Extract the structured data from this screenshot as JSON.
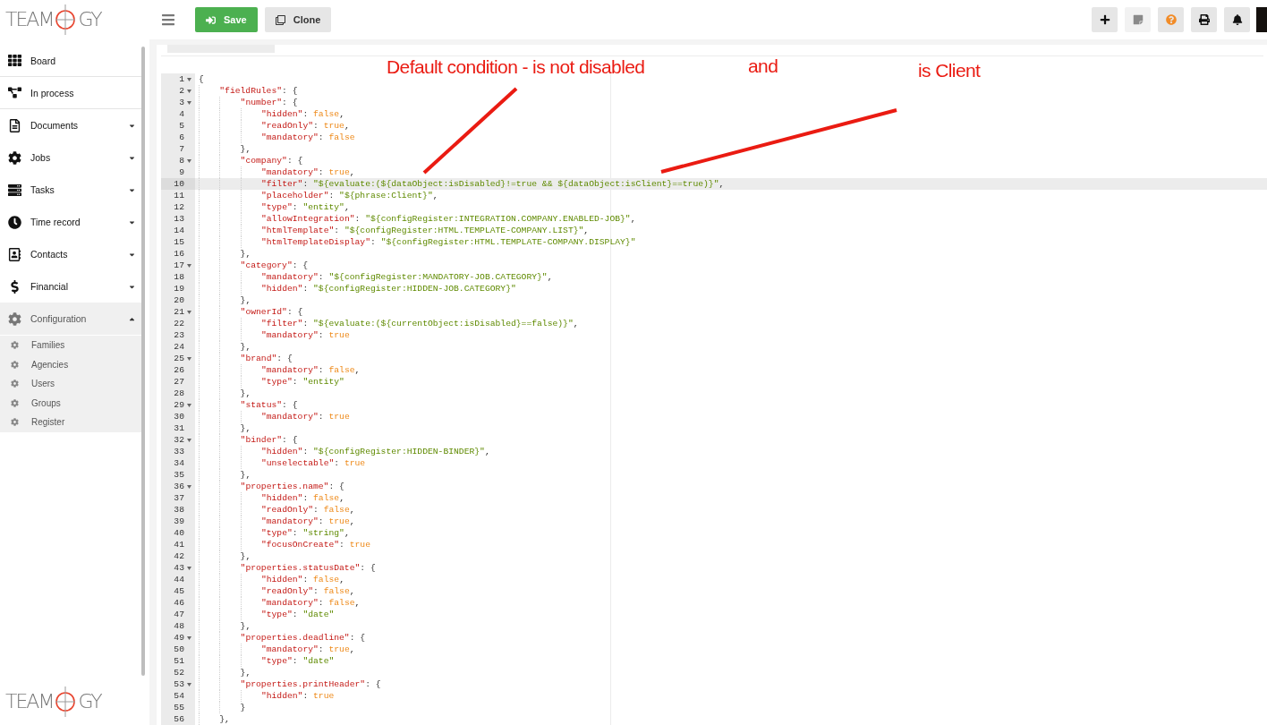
{
  "logo": {
    "before": "TEAM",
    "after": "GY"
  },
  "toolbar": {
    "buttons": [
      {
        "label": "Save",
        "kind": "primary"
      },
      {
        "label": "Clone",
        "kind": "secondary"
      }
    ],
    "actions": [
      {
        "disabled": false
      },
      {
        "disabled": true
      },
      {
        "disabled": false
      },
      {
        "disabled": false
      },
      {
        "disabled": false
      }
    ]
  },
  "sidebar": {
    "items": [
      {
        "label": "Board",
        "kind": "link"
      },
      {
        "label": "In process",
        "kind": "link"
      },
      {
        "label": "Documents",
        "kind": "group",
        "expanded": false
      },
      {
        "label": "Jobs",
        "kind": "group",
        "expanded": false
      },
      {
        "label": "Tasks",
        "kind": "group",
        "expanded": false
      },
      {
        "label": "Time record",
        "kind": "group",
        "expanded": false
      },
      {
        "label": "Contacts",
        "kind": "group",
        "expanded": false
      },
      {
        "label": "Financial",
        "kind": "group",
        "expanded": false
      },
      {
        "label": "Configuration",
        "kind": "group",
        "expanded": true,
        "children": [
          {
            "label": "Families"
          },
          {
            "label": "Agencies"
          },
          {
            "label": "Users"
          },
          {
            "label": "Groups"
          },
          {
            "label": "Register"
          }
        ]
      }
    ]
  },
  "footer_logo": {
    "before": "TEAM",
    "after": "GY"
  },
  "annotations": [
    {
      "text": "Default condition - is not disabled"
    },
    {
      "text": "and"
    },
    {
      "text": "is Client"
    }
  ],
  "code": {
    "lines": [
      {
        "number": "1",
        "selected": false,
        "tokens": [
          {
            "kind": "punct",
            "text": "{"
          }
        ],
        "children": [
          {
            "number": "2",
            "selected": false,
            "tokens": [
              {
                "kind": "key",
                "text": "\"fieldRules\""
              },
              {
                "kind": "punct",
                "text": ": {"
              }
            ],
            "children": [
              {
                "number": "3",
                "selected": false,
                "tokens": [
                  {
                    "kind": "key",
                    "text": "\"number\""
                  },
                  {
                    "kind": "punct",
                    "text": ": {"
                  }
                ],
                "children": [
                  {
                    "number": "4",
                    "selected": false,
                    "tokens": [
                      {
                        "kind": "key",
                        "text": "\"hidden\""
                      },
                      {
                        "kind": "punct",
                        "text": ": "
                      },
                      {
                        "kind": "bool",
                        "text": "false"
                      },
                      {
                        "kind": "punct",
                        "text": ","
                      }
                    ]
                  },
                  {
                    "number": "5",
                    "selected": false,
                    "tokens": [
                      {
                        "kind": "key",
                        "text": "\"readOnly\""
                      },
                      {
                        "kind": "punct",
                        "text": ": "
                      },
                      {
                        "kind": "bool",
                        "text": "true"
                      },
                      {
                        "kind": "punct",
                        "text": ","
                      }
                    ]
                  },
                  {
                    "number": "6",
                    "selected": false,
                    "tokens": [
                      {
                        "kind": "key",
                        "text": "\"mandatory\""
                      },
                      {
                        "kind": "punct",
                        "text": ": "
                      },
                      {
                        "kind": "bool",
                        "text": "false"
                      }
                    ]
                  }
                ]
              },
              {
                "number": "7",
                "selected": false,
                "tokens": [
                  {
                    "kind": "punct",
                    "text": "},"
                  }
                ]
              },
              {
                "number": "8",
                "selected": false,
                "tokens": [
                  {
                    "kind": "key",
                    "text": "\"company\""
                  },
                  {
                    "kind": "punct",
                    "text": ": {"
                  }
                ],
                "children": [
                  {
                    "number": "9",
                    "selected": false,
                    "tokens": [
                      {
                        "kind": "key",
                        "text": "\"mandatory\""
                      },
                      {
                        "kind": "punct",
                        "text": ": "
                      },
                      {
                        "kind": "bool",
                        "text": "true"
                      },
                      {
                        "kind": "punct",
                        "text": ","
                      }
                    ]
                  },
                  {
                    "number": "10",
                    "selected": true,
                    "tokens": [
                      {
                        "kind": "key",
                        "text": "\"filter\""
                      },
                      {
                        "kind": "punct",
                        "text": ": "
                      },
                      {
                        "kind": "string",
                        "text": "\"${evaluate:(${dataObject:isDisabled}!=true && ${dataObject:isClient}==true)}\""
                      },
                      {
                        "kind": "punct",
                        "text": ","
                      }
                    ]
                  },
                  {
                    "number": "11",
                    "selected": false,
                    "tokens": [
                      {
                        "kind": "key",
                        "text": "\"placeholder\""
                      },
                      {
                        "kind": "punct",
                        "text": ": "
                      },
                      {
                        "kind": "string",
                        "text": "\"${phrase:Client}\""
                      },
                      {
                        "kind": "punct",
                        "text": ","
                      }
                    ]
                  },
                  {
                    "number": "12",
                    "selected": false,
                    "tokens": [
                      {
                        "kind": "key",
                        "text": "\"type\""
                      },
                      {
                        "kind": "punct",
                        "text": ": "
                      },
                      {
                        "kind": "string",
                        "text": "\"entity\""
                      },
                      {
                        "kind": "punct",
                        "text": ","
                      }
                    ]
                  },
                  {
                    "number": "13",
                    "selected": false,
                    "tokens": [
                      {
                        "kind": "key",
                        "text": "\"allowIntegration\""
                      },
                      {
                        "kind": "punct",
                        "text": ": "
                      },
                      {
                        "kind": "string",
                        "text": "\"${configRegister:INTEGRATION.COMPANY.ENABLED-JOB}\""
                      },
                      {
                        "kind": "punct",
                        "text": ","
                      }
                    ]
                  },
                  {
                    "number": "14",
                    "selected": false,
                    "tokens": [
                      {
                        "kind": "key",
                        "text": "\"htmlTemplate\""
                      },
                      {
                        "kind": "punct",
                        "text": ": "
                      },
                      {
                        "kind": "string",
                        "text": "\"${configRegister:HTML.TEMPLATE-COMPANY.LIST}\""
                      },
                      {
                        "kind": "punct",
                        "text": ","
                      }
                    ]
                  },
                  {
                    "number": "15",
                    "selected": false,
                    "tokens": [
                      {
                        "kind": "key",
                        "text": "\"htmlTemplateDisplay\""
                      },
                      {
                        "kind": "punct",
                        "text": ": "
                      },
                      {
                        "kind": "string",
                        "text": "\"${configRegister:HTML.TEMPLATE-COMPANY.DISPLAY}\""
                      }
                    ]
                  }
                ]
              },
              {
                "number": "16",
                "selected": false,
                "tokens": [
                  {
                    "kind": "punct",
                    "text": "},"
                  }
                ]
              },
              {
                "number": "17",
                "selected": false,
                "tokens": [
                  {
                    "kind": "key",
                    "text": "\"category\""
                  },
                  {
                    "kind": "punct",
                    "text": ": {"
                  }
                ],
                "children": [
                  {
                    "number": "18",
                    "selected": false,
                    "tokens": [
                      {
                        "kind": "key",
                        "text": "\"mandatory\""
                      },
                      {
                        "kind": "punct",
                        "text": ": "
                      },
                      {
                        "kind": "string",
                        "text": "\"${configRegister:MANDATORY-JOB.CATEGORY}\""
                      },
                      {
                        "kind": "punct",
                        "text": ","
                      }
                    ]
                  },
                  {
                    "number": "19",
                    "selected": false,
                    "tokens": [
                      {
                        "kind": "key",
                        "text": "\"hidden\""
                      },
                      {
                        "kind": "punct",
                        "text": ": "
                      },
                      {
                        "kind": "string",
                        "text": "\"${configRegister:HIDDEN-JOB.CATEGORY}\""
                      }
                    ]
                  }
                ]
              },
              {
                "number": "20",
                "selected": false,
                "tokens": [
                  {
                    "kind": "punct",
                    "text": "},"
                  }
                ]
              },
              {
                "number": "21",
                "selected": false,
                "tokens": [
                  {
                    "kind": "key",
                    "text": "\"ownerId\""
                  },
                  {
                    "kind": "punct",
                    "text": ": {"
                  }
                ],
                "children": [
                  {
                    "number": "22",
                    "selected": false,
                    "tokens": [
                      {
                        "kind": "key",
                        "text": "\"filter\""
                      },
                      {
                        "kind": "punct",
                        "text": ": "
                      },
                      {
                        "kind": "string",
                        "text": "\"${evaluate:(${currentObject:isDisabled}==false)}\""
                      },
                      {
                        "kind": "punct",
                        "text": ","
                      }
                    ]
                  },
                  {
                    "number": "23",
                    "selected": false,
                    "tokens": [
                      {
                        "kind": "key",
                        "text": "\"mandatory\""
                      },
                      {
                        "kind": "punct",
                        "text": ": "
                      },
                      {
                        "kind": "bool",
                        "text": "true"
                      }
                    ]
                  }
                ]
              },
              {
                "number": "24",
                "selected": false,
                "tokens": [
                  {
                    "kind": "punct",
                    "text": "},"
                  }
                ]
              },
              {
                "number": "25",
                "selected": false,
                "tokens": [
                  {
                    "kind": "key",
                    "text": "\"brand\""
                  },
                  {
                    "kind": "punct",
                    "text": ": {"
                  }
                ],
                "children": [
                  {
                    "number": "26",
                    "selected": false,
                    "tokens": [
                      {
                        "kind": "key",
                        "text": "\"mandatory\""
                      },
                      {
                        "kind": "punct",
                        "text": ": "
                      },
                      {
                        "kind": "bool",
                        "text": "false"
                      },
                      {
                        "kind": "punct",
                        "text": ","
                      }
                    ]
                  },
                  {
                    "number": "27",
                    "selected": false,
                    "tokens": [
                      {
                        "kind": "key",
                        "text": "\"type\""
                      },
                      {
                        "kind": "punct",
                        "text": ": "
                      },
                      {
                        "kind": "string",
                        "text": "\"entity\""
                      }
                    ]
                  }
                ]
              },
              {
                "number": "28",
                "selected": false,
                "tokens": [
                  {
                    "kind": "punct",
                    "text": "},"
                  }
                ]
              },
              {
                "number": "29",
                "selected": false,
                "tokens": [
                  {
                    "kind": "key",
                    "text": "\"status\""
                  },
                  {
                    "kind": "punct",
                    "text": ": {"
                  }
                ],
                "children": [
                  {
                    "number": "30",
                    "selected": false,
                    "tokens": [
                      {
                        "kind": "key",
                        "text": "\"mandatory\""
                      },
                      {
                        "kind": "punct",
                        "text": ": "
                      },
                      {
                        "kind": "bool",
                        "text": "true"
                      }
                    ]
                  }
                ]
              },
              {
                "number": "31",
                "selected": false,
                "tokens": [
                  {
                    "kind": "punct",
                    "text": "},"
                  }
                ]
              },
              {
                "number": "32",
                "selected": false,
                "tokens": [
                  {
                    "kind": "key",
                    "text": "\"binder\""
                  },
                  {
                    "kind": "punct",
                    "text": ": {"
                  }
                ],
                "children": [
                  {
                    "number": "33",
                    "selected": false,
                    "tokens": [
                      {
                        "kind": "key",
                        "text": "\"hidden\""
                      },
                      {
                        "kind": "punct",
                        "text": ": "
                      },
                      {
                        "kind": "string",
                        "text": "\"${configRegister:HIDDEN-BINDER}\""
                      },
                      {
                        "kind": "punct",
                        "text": ","
                      }
                    ]
                  },
                  {
                    "number": "34",
                    "selected": false,
                    "tokens": [
                      {
                        "kind": "key",
                        "text": "\"unselectable\""
                      },
                      {
                        "kind": "punct",
                        "text": ": "
                      },
                      {
                        "kind": "bool",
                        "text": "true"
                      }
                    ]
                  }
                ]
              },
              {
                "number": "35",
                "selected": false,
                "tokens": [
                  {
                    "kind": "punct",
                    "text": "},"
                  }
                ]
              },
              {
                "number": "36",
                "selected": false,
                "tokens": [
                  {
                    "kind": "key",
                    "text": "\"properties.name\""
                  },
                  {
                    "kind": "punct",
                    "text": ": {"
                  }
                ],
                "children": [
                  {
                    "number": "37",
                    "selected": false,
                    "tokens": [
                      {
                        "kind": "key",
                        "text": "\"hidden\""
                      },
                      {
                        "kind": "punct",
                        "text": ": "
                      },
                      {
                        "kind": "bool",
                        "text": "false"
                      },
                      {
                        "kind": "punct",
                        "text": ","
                      }
                    ]
                  },
                  {
                    "number": "38",
                    "selected": false,
                    "tokens": [
                      {
                        "kind": "key",
                        "text": "\"readOnly\""
                      },
                      {
                        "kind": "punct",
                        "text": ": "
                      },
                      {
                        "kind": "bool",
                        "text": "false"
                      },
                      {
                        "kind": "punct",
                        "text": ","
                      }
                    ]
                  },
                  {
                    "number": "39",
                    "selected": false,
                    "tokens": [
                      {
                        "kind": "key",
                        "text": "\"mandatory\""
                      },
                      {
                        "kind": "punct",
                        "text": ": "
                      },
                      {
                        "kind": "bool",
                        "text": "true"
                      },
                      {
                        "kind": "punct",
                        "text": ","
                      }
                    ]
                  },
                  {
                    "number": "40",
                    "selected": false,
                    "tokens": [
                      {
                        "kind": "key",
                        "text": "\"type\""
                      },
                      {
                        "kind": "punct",
                        "text": ": "
                      },
                      {
                        "kind": "string",
                        "text": "\"string\""
                      },
                      {
                        "kind": "punct",
                        "text": ","
                      }
                    ]
                  },
                  {
                    "number": "41",
                    "selected": false,
                    "tokens": [
                      {
                        "kind": "key",
                        "text": "\"focusOnCreate\""
                      },
                      {
                        "kind": "punct",
                        "text": ": "
                      },
                      {
                        "kind": "bool",
                        "text": "true"
                      }
                    ]
                  }
                ]
              },
              {
                "number": "42",
                "selected": false,
                "tokens": [
                  {
                    "kind": "punct",
                    "text": "},"
                  }
                ]
              },
              {
                "number": "43",
                "selected": false,
                "tokens": [
                  {
                    "kind": "key",
                    "text": "\"properties.statusDate\""
                  },
                  {
                    "kind": "punct",
                    "text": ": {"
                  }
                ],
                "children": [
                  {
                    "number": "44",
                    "selected": false,
                    "tokens": [
                      {
                        "kind": "key",
                        "text": "\"hidden\""
                      },
                      {
                        "kind": "punct",
                        "text": ": "
                      },
                      {
                        "kind": "bool",
                        "text": "false"
                      },
                      {
                        "kind": "punct",
                        "text": ","
                      }
                    ]
                  },
                  {
                    "number": "45",
                    "selected": false,
                    "tokens": [
                      {
                        "kind": "key",
                        "text": "\"readOnly\""
                      },
                      {
                        "kind": "punct",
                        "text": ": "
                      },
                      {
                        "kind": "bool",
                        "text": "false"
                      },
                      {
                        "kind": "punct",
                        "text": ","
                      }
                    ]
                  },
                  {
                    "number": "46",
                    "selected": false,
                    "tokens": [
                      {
                        "kind": "key",
                        "text": "\"mandatory\""
                      },
                      {
                        "kind": "punct",
                        "text": ": "
                      },
                      {
                        "kind": "bool",
                        "text": "false"
                      },
                      {
                        "kind": "punct",
                        "text": ","
                      }
                    ]
                  },
                  {
                    "number": "47",
                    "selected": false,
                    "tokens": [
                      {
                        "kind": "key",
                        "text": "\"type\""
                      },
                      {
                        "kind": "punct",
                        "text": ": "
                      },
                      {
                        "kind": "string",
                        "text": "\"date\""
                      }
                    ]
                  }
                ]
              },
              {
                "number": "48",
                "selected": false,
                "tokens": [
                  {
                    "kind": "punct",
                    "text": "},"
                  }
                ]
              },
              {
                "number": "49",
                "selected": false,
                "tokens": [
                  {
                    "kind": "key",
                    "text": "\"properties.deadline\""
                  },
                  {
                    "kind": "punct",
                    "text": ": {"
                  }
                ],
                "children": [
                  {
                    "number": "50",
                    "selected": false,
                    "tokens": [
                      {
                        "kind": "key",
                        "text": "\"mandatory\""
                      },
                      {
                        "kind": "punct",
                        "text": ": "
                      },
                      {
                        "kind": "bool",
                        "text": "true"
                      },
                      {
                        "kind": "punct",
                        "text": ","
                      }
                    ]
                  },
                  {
                    "number": "51",
                    "selected": false,
                    "tokens": [
                      {
                        "kind": "key",
                        "text": "\"type\""
                      },
                      {
                        "kind": "punct",
                        "text": ": "
                      },
                      {
                        "kind": "string",
                        "text": "\"date\""
                      }
                    ]
                  }
                ]
              },
              {
                "number": "52",
                "selected": false,
                "tokens": [
                  {
                    "kind": "punct",
                    "text": "},"
                  }
                ]
              },
              {
                "number": "53",
                "selected": false,
                "tokens": [
                  {
                    "kind": "key",
                    "text": "\"properties.printHeader\""
                  },
                  {
                    "kind": "punct",
                    "text": ": {"
                  }
                ],
                "children": [
                  {
                    "number": "54",
                    "selected": false,
                    "tokens": [
                      {
                        "kind": "key",
                        "text": "\"hidden\""
                      },
                      {
                        "kind": "punct",
                        "text": ": "
                      },
                      {
                        "kind": "bool",
                        "text": "true"
                      }
                    ]
                  }
                ]
              },
              {
                "number": "55",
                "selected": false,
                "tokens": [
                  {
                    "kind": "punct",
                    "text": "}"
                  }
                ]
              }
            ]
          },
          {
            "number": "56",
            "selected": false,
            "tokens": [
              {
                "kind": "punct",
                "text": "},"
              }
            ]
          }
        ]
      }
    ]
  }
}
